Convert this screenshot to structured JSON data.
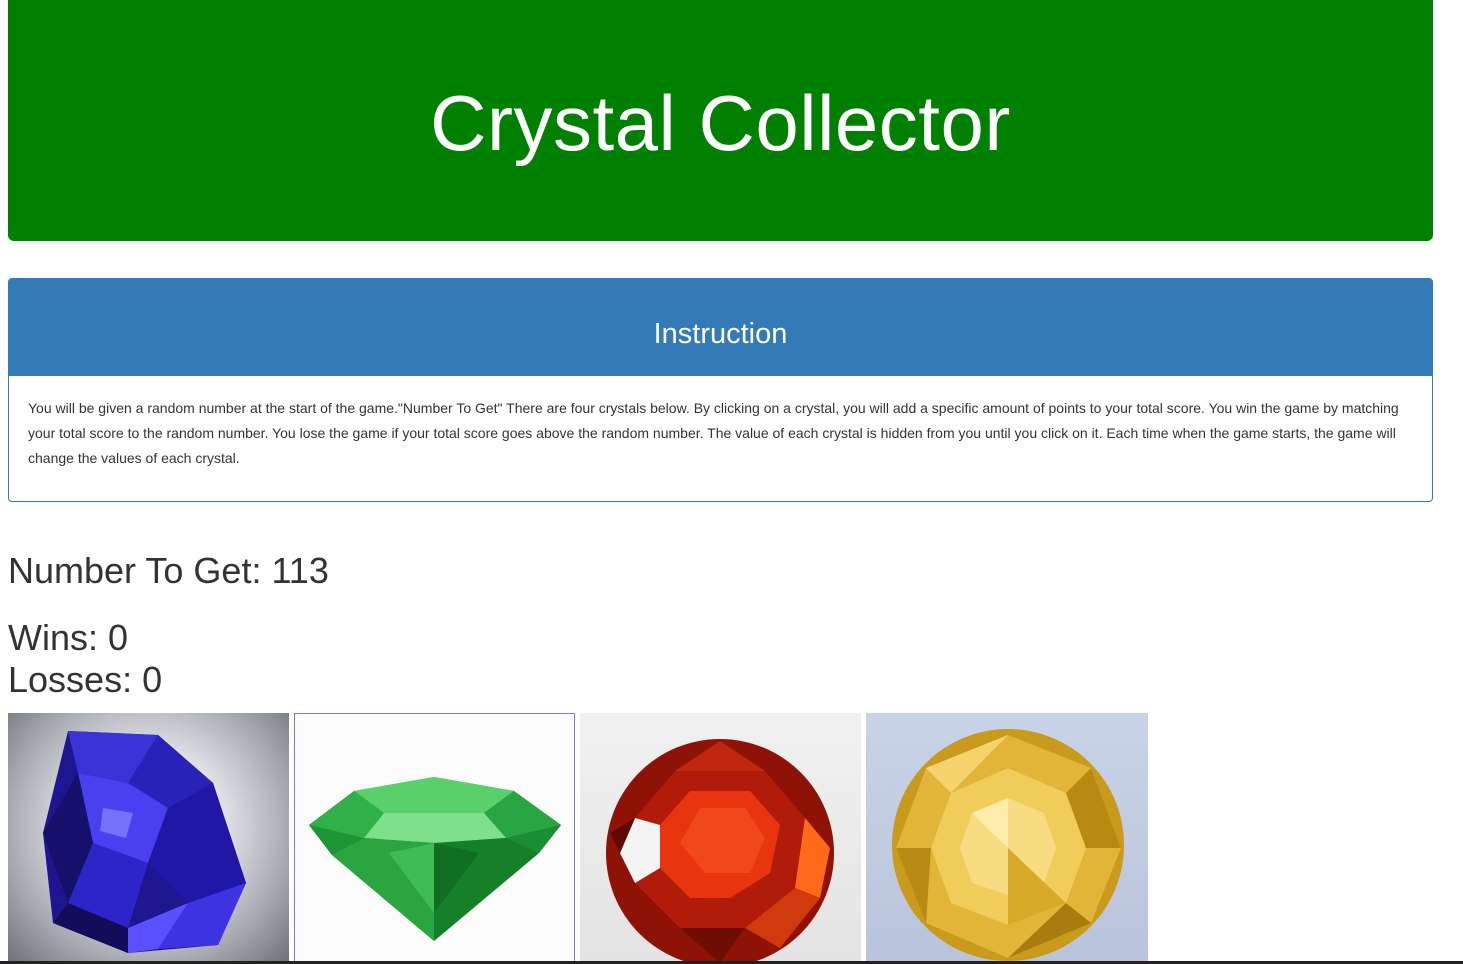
{
  "header": {
    "title": "Crystal Collector",
    "bg_color": "#008000"
  },
  "instruction": {
    "heading": "Instruction",
    "body": "You will be given a random number at the start of the game.\"Number To Get\" There are four crystals below. By clicking on a crystal, you will add a specific amount of points to your total score. You win the game by matching your total score to the random number. You lose the game if your total score goes above the random number. The value of each crystal is hidden from you until you click on it. Each time when the game starts, the game will change the values of each crystal.",
    "heading_color": "#337ab7"
  },
  "game": {
    "number_to_get": "Number To Get: 113",
    "wins": "Wins: 0",
    "losses": "Losses: 0"
  },
  "crystals": [
    {
      "name": "blue-crystal",
      "color": "#2a1fc7"
    },
    {
      "name": "green-crystal",
      "color": "#1f9a3a"
    },
    {
      "name": "red-crystal",
      "color": "#c21e08"
    },
    {
      "name": "yellow-crystal",
      "color": "#e0b42a"
    }
  ]
}
